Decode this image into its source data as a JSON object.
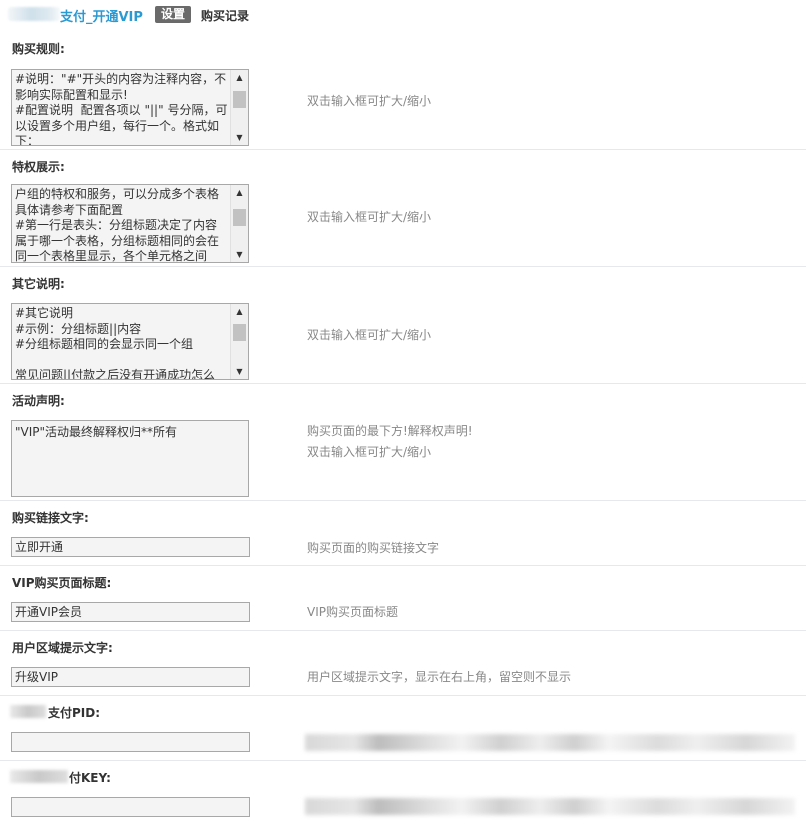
{
  "header": {
    "title": "支付_开通VIP",
    "tab_active": "设置",
    "tab_other": "购买记录"
  },
  "sections": {
    "rules": {
      "label": "购买规则:",
      "content": "#说明：\"#\"开头的内容为注释内容，不影响实际配置和显示!\n#配置说明  配置各项以 \"||\" 号分隔，可以设置多个用户组，每行一个。格式如下：",
      "hint": "双击输入框可扩大/缩小"
    },
    "privileges": {
      "label": "特权展示:",
      "content": "户组的特权和服务，可以分成多个表格具体请参考下面配置\n#第一行是表头：分组标题决定了内容属于哪一个表格，分组标题相同的会在同一个表格里显示，各个单元格之间",
      "hint": "双击输入框可扩大/缩小"
    },
    "other": {
      "label": "其它说明:",
      "content": "#其它说明\n#示例：分组标题||内容\n#分组标题相同的会显示同一个组\n\n常见问题||付款之后没有开通成功怎么",
      "hint": "双击输入框可扩大/缩小"
    },
    "activity": {
      "label": "活动声明:",
      "content": "\"VIP\"活动最终解释权归**所有",
      "hint1": "购买页面的最下方!解释权声明!",
      "hint2": "双击输入框可扩大/缩小"
    },
    "link_text": {
      "label": "购买链接文字:",
      "value": "立即开通",
      "hint": "购买页面的购买链接文字"
    },
    "page_title": {
      "label": "VIP购买页面标题:",
      "value": "开通VIP会员",
      "hint": "VIP购买页面标题"
    },
    "user_area": {
      "label": "用户区域提示文字:",
      "value": "升级VIP",
      "hint": "用户区域提示文字，显示在右上角，留空则不显示"
    },
    "pid": {
      "label": "支付PID:",
      "value": ""
    },
    "key": {
      "label": "付KEY:",
      "value": ""
    }
  }
}
